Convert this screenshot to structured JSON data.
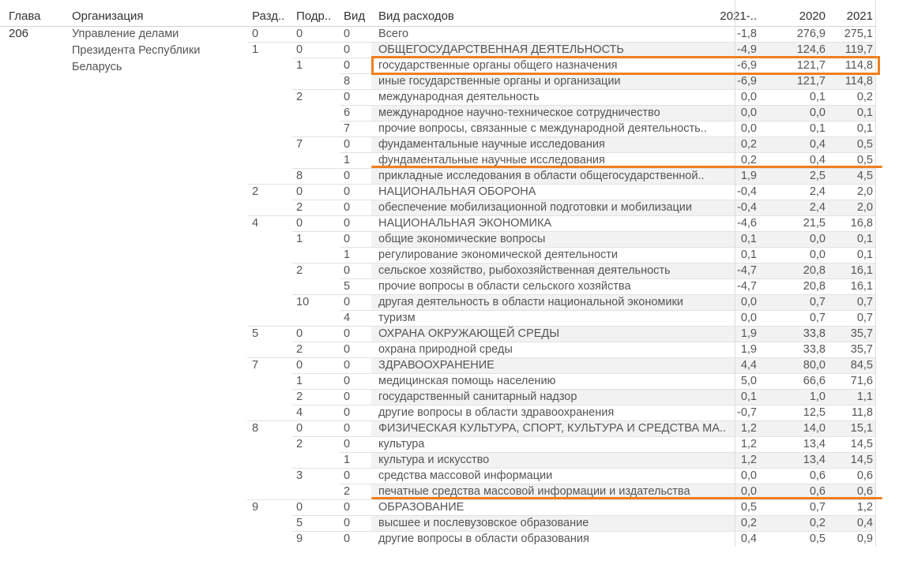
{
  "headers": {
    "glava": "Глава",
    "org": "Организация",
    "razdel": "Разд..",
    "podrazdel": "Подр..",
    "vid": "Вид",
    "vid_rashodov": "Вид расходов",
    "diff": "2021-..",
    "y2020": "2020",
    "y2021": "2021"
  },
  "glava": "206",
  "organization": [
    "Управление делами",
    "Президента Республики",
    "Беларусь"
  ],
  "annotation_color": "#f07f1e",
  "highlighted_row_index": 2,
  "underlined_row_indices": [
    8,
    29
  ],
  "rows": [
    {
      "raz": "0",
      "pod": "0",
      "vid": "0",
      "name": "Всего",
      "diff": "-1,8",
      "y2020": "276,9",
      "y2021": "275,1"
    },
    {
      "raz": "1",
      "pod": "0",
      "vid": "0",
      "name": "ОБЩЕГОСУДАРСТВЕННАЯ ДЕЯТЕЛЬНОСТЬ",
      "diff": "-4,9",
      "y2020": "124,6",
      "y2021": "119,7"
    },
    {
      "raz": "",
      "pod": "1",
      "vid": "0",
      "name": "государственные органы общего назначения",
      "diff": "-6,9",
      "y2020": "121,7",
      "y2021": "114,8"
    },
    {
      "raz": "",
      "pod": "",
      "vid": "8",
      "name": "иные государственные органы и организации",
      "diff": "-6,9",
      "y2020": "121,7",
      "y2021": "114,8"
    },
    {
      "raz": "",
      "pod": "2",
      "vid": "0",
      "name": "международная деятельность",
      "diff": "0,0",
      "y2020": "0,1",
      "y2021": "0,2"
    },
    {
      "raz": "",
      "pod": "",
      "vid": "6",
      "name": "международное научно-техническое сотрудничество",
      "diff": "0,0",
      "y2020": "0,0",
      "y2021": "0,1"
    },
    {
      "raz": "",
      "pod": "",
      "vid": "7",
      "name": "прочие вопросы, связанные с международной деятельность..",
      "diff": "0,0",
      "y2020": "0,1",
      "y2021": "0,1"
    },
    {
      "raz": "",
      "pod": "7",
      "vid": "0",
      "name": "фундаментальные научные исследования",
      "diff": "0,2",
      "y2020": "0,4",
      "y2021": "0,5"
    },
    {
      "raz": "",
      "pod": "",
      "vid": "1",
      "name": "фундаментальные научные исследования",
      "diff": "0,2",
      "y2020": "0,4",
      "y2021": "0,5"
    },
    {
      "raz": "",
      "pod": "8",
      "vid": "0",
      "name": "прикладные исследования в области общегосударственной..",
      "diff": "1,9",
      "y2020": "2,5",
      "y2021": "4,5"
    },
    {
      "raz": "2",
      "pod": "0",
      "vid": "0",
      "name": "НАЦИОНАЛЬНАЯ ОБОРОНА",
      "diff": "-0,4",
      "y2020": "2,4",
      "y2021": "2,0"
    },
    {
      "raz": "",
      "pod": "2",
      "vid": "0",
      "name": "обеспечение мобилизационной подготовки и мобилизации",
      "diff": "-0,4",
      "y2020": "2,4",
      "y2021": "2,0"
    },
    {
      "raz": "4",
      "pod": "0",
      "vid": "0",
      "name": "НАЦИОНАЛЬНАЯ ЭКОНОМИКА",
      "diff": "-4,6",
      "y2020": "21,5",
      "y2021": "16,8"
    },
    {
      "raz": "",
      "pod": "1",
      "vid": "0",
      "name": "общие экономические вопросы",
      "diff": "0,1",
      "y2020": "0,0",
      "y2021": "0,1"
    },
    {
      "raz": "",
      "pod": "",
      "vid": "1",
      "name": "регулирование экономической деятельности",
      "diff": "0,1",
      "y2020": "0,0",
      "y2021": "0,1"
    },
    {
      "raz": "",
      "pod": "2",
      "vid": "0",
      "name": "сельское хозяйство, рыбохозяйственная деятельность",
      "diff": "-4,7",
      "y2020": "20,8",
      "y2021": "16,1"
    },
    {
      "raz": "",
      "pod": "",
      "vid": "5",
      "name": "прочие вопросы в области сельского хозяйства",
      "diff": "-4,7",
      "y2020": "20,8",
      "y2021": "16,1"
    },
    {
      "raz": "",
      "pod": "10",
      "vid": "0",
      "name": "другая деятельность в области национальной экономики",
      "diff": "0,0",
      "y2020": "0,7",
      "y2021": "0,7"
    },
    {
      "raz": "",
      "pod": "",
      "vid": "4",
      "name": "туризм",
      "diff": "0,0",
      "y2020": "0,7",
      "y2021": "0,7"
    },
    {
      "raz": "5",
      "pod": "0",
      "vid": "0",
      "name": "ОХРАНА ОКРУЖАЮЩЕЙ СРЕДЫ",
      "diff": "1,9",
      "y2020": "33,8",
      "y2021": "35,7"
    },
    {
      "raz": "",
      "pod": "2",
      "vid": "0",
      "name": "охрана природной среды",
      "diff": "1,9",
      "y2020": "33,8",
      "y2021": "35,7"
    },
    {
      "raz": "7",
      "pod": "0",
      "vid": "0",
      "name": "ЗДРАВООХРАНЕНИЕ",
      "diff": "4,4",
      "y2020": "80,0",
      "y2021": "84,5"
    },
    {
      "raz": "",
      "pod": "1",
      "vid": "0",
      "name": "медицинская помощь населению",
      "diff": "5,0",
      "y2020": "66,6",
      "y2021": "71,6"
    },
    {
      "raz": "",
      "pod": "2",
      "vid": "0",
      "name": "государственный санитарный надзор",
      "diff": "0,1",
      "y2020": "1,0",
      "y2021": "1,1"
    },
    {
      "raz": "",
      "pod": "4",
      "vid": "0",
      "name": "другие вопросы в области здравоохранения",
      "diff": "-0,7",
      "y2020": "12,5",
      "y2021": "11,8"
    },
    {
      "raz": "8",
      "pod": "0",
      "vid": "0",
      "name": "ФИЗИЧЕСКАЯ КУЛЬТУРА, СПОРТ, КУЛЬТУРА И СРЕДСТВА МА..",
      "diff": "1,2",
      "y2020": "14,0",
      "y2021": "15,1"
    },
    {
      "raz": "",
      "pod": "2",
      "vid": "0",
      "name": "культура",
      "diff": "1,2",
      "y2020": "13,4",
      "y2021": "14,5"
    },
    {
      "raz": "",
      "pod": "",
      "vid": "1",
      "name": "культура и искусство",
      "diff": "1,2",
      "y2020": "13,4",
      "y2021": "14,5"
    },
    {
      "raz": "",
      "pod": "3",
      "vid": "0",
      "name": "средства массовой информации",
      "diff": "0,0",
      "y2020": "0,6",
      "y2021": "0,6"
    },
    {
      "raz": "",
      "pod": "",
      "vid": "2",
      "name": "печатные средства массовой информации и издательства",
      "diff": "0,0",
      "y2020": "0,6",
      "y2021": "0,6"
    },
    {
      "raz": "9",
      "pod": "0",
      "vid": "0",
      "name": "ОБРАЗОВАНИЕ",
      "diff": "0,5",
      "y2020": "0,7",
      "y2021": "1,2"
    },
    {
      "raz": "",
      "pod": "5",
      "vid": "0",
      "name": "высшее и послевузовское образование",
      "diff": "0,2",
      "y2020": "0,2",
      "y2021": "0,4"
    },
    {
      "raz": "",
      "pod": "9",
      "vid": "0",
      "name": "другие вопросы в области образования",
      "diff": "0,4",
      "y2020": "0,5",
      "y2021": "0,9"
    }
  ]
}
